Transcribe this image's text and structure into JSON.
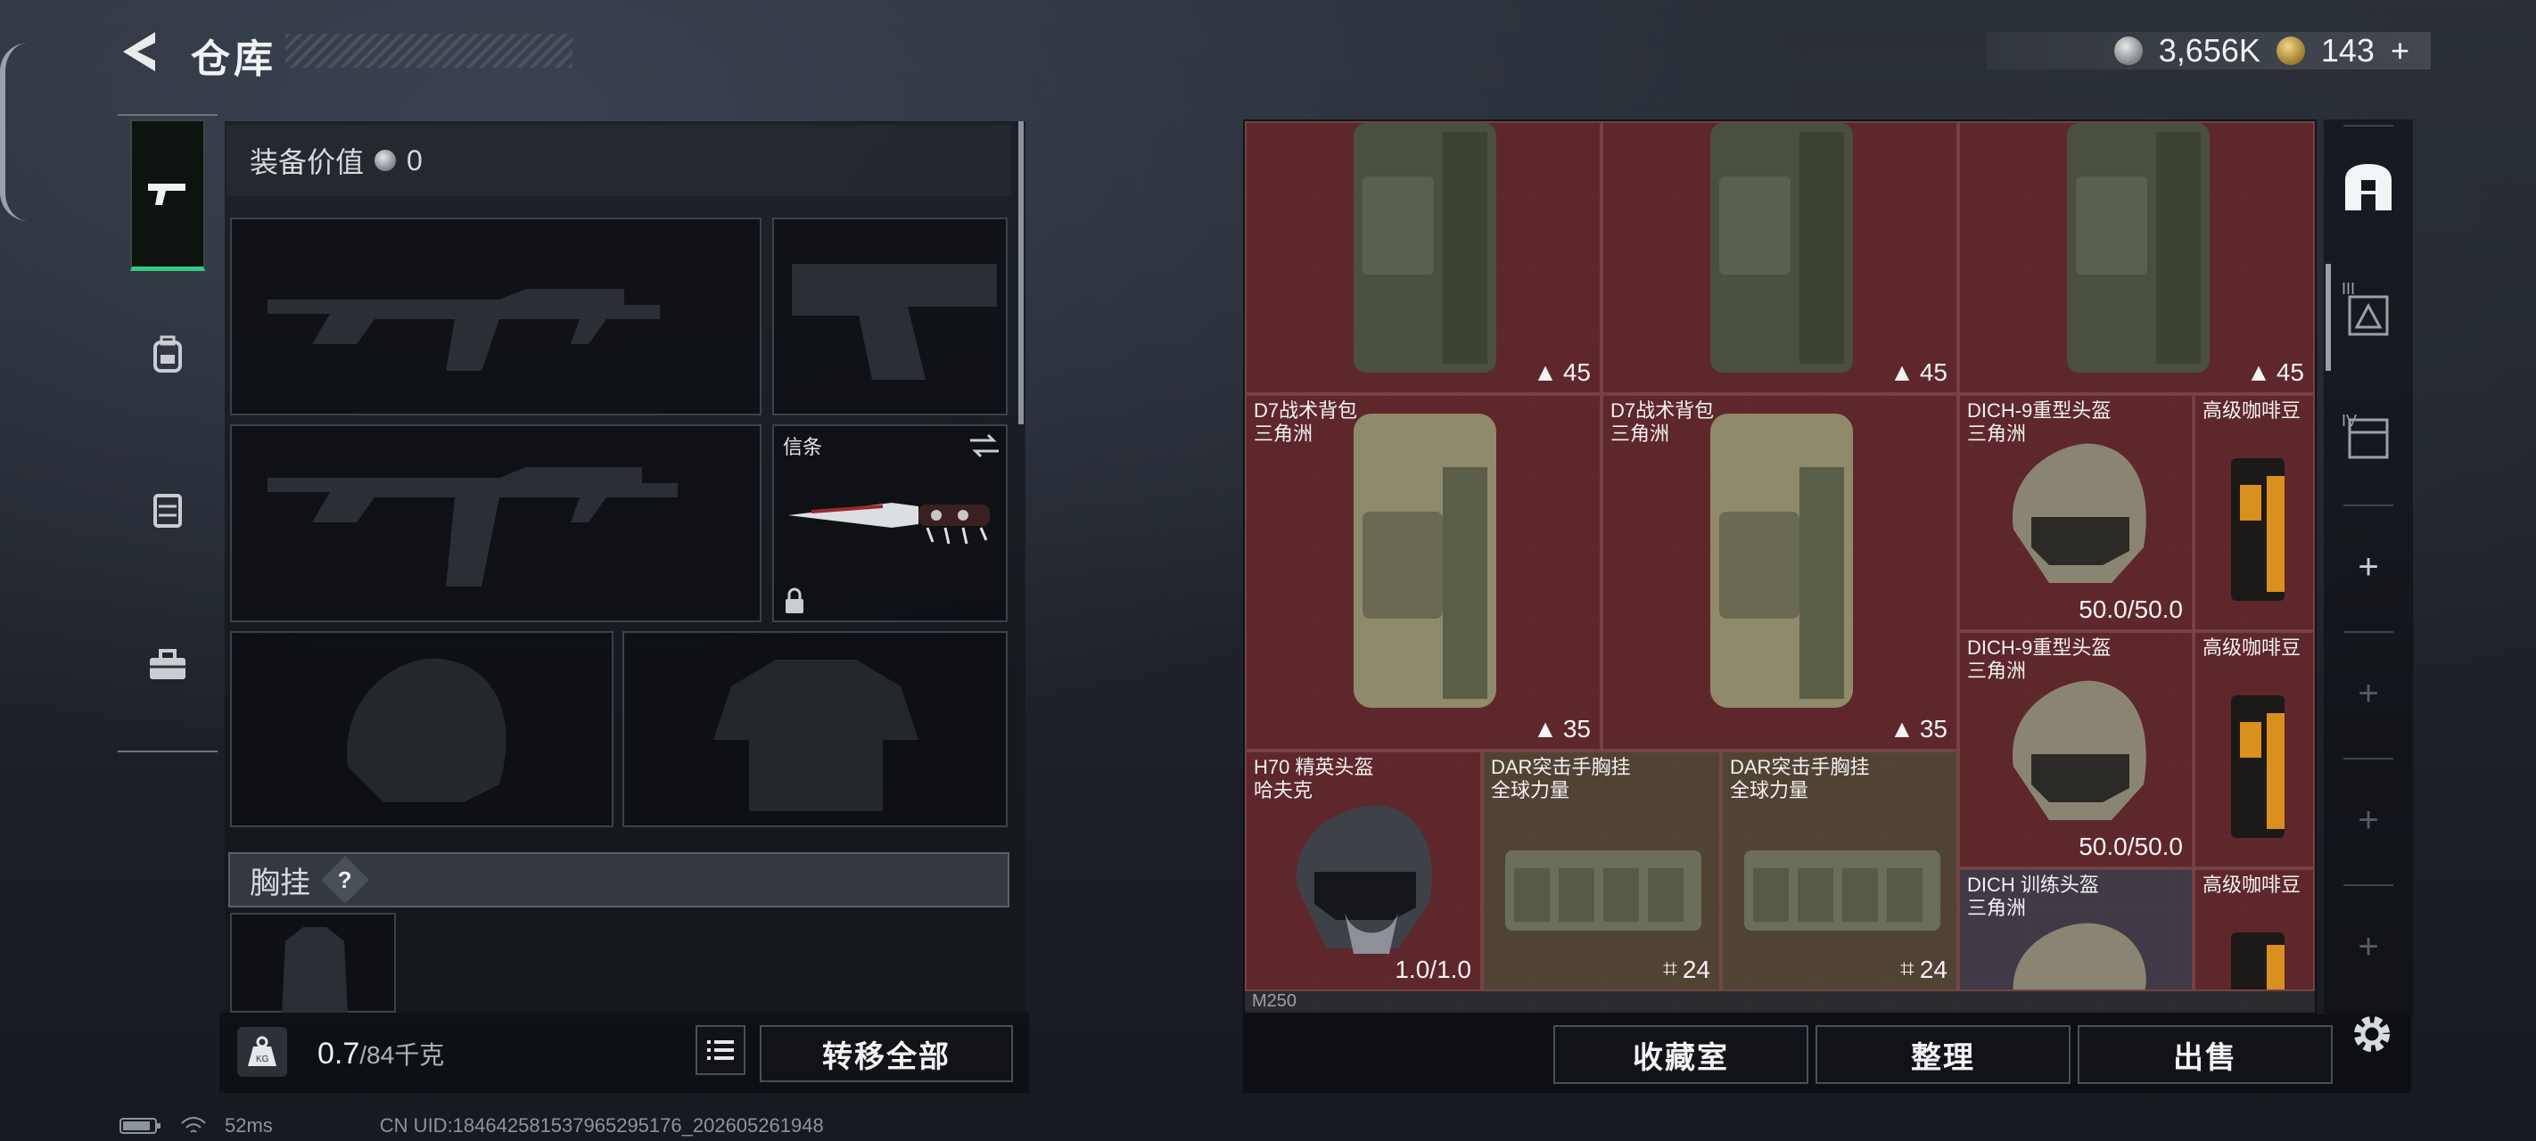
{
  "header": {
    "title": "仓库",
    "silver": "3,656K",
    "gold": "143",
    "gold_plus": "+"
  },
  "sidebar": {
    "tabs": [
      "gun-icon",
      "backpack-icon",
      "vest-icon",
      "toolbox-icon"
    ]
  },
  "equipment": {
    "value_label": "装备价值",
    "value_amount": "0",
    "melee_label": "信条",
    "chest_label": "胸挂",
    "chest_help": "?",
    "weight_current": "0.7",
    "weight_total": "/84千克",
    "transfer_all": "转移全部"
  },
  "stash": {
    "items": [
      {
        "name1": "",
        "name2": "",
        "stat": "45",
        "type": "backpack"
      },
      {
        "name1": "",
        "name2": "",
        "stat": "45",
        "type": "backpack"
      },
      {
        "name1": "",
        "name2": "",
        "stat": "45",
        "type": "backpack"
      },
      {
        "name1": "D7战术背包",
        "name2": "三角洲",
        "stat": "35",
        "type": "backpack"
      },
      {
        "name1": "D7战术背包",
        "name2": "三角洲",
        "stat": "35",
        "type": "backpack"
      },
      {
        "name1": "DICH-9重型头盔",
        "name2": "三角洲",
        "stat": "50.0/50.0",
        "type": "helmet"
      },
      {
        "name1": "高级咖啡豆",
        "name2": "",
        "stat": "",
        "type": "coffee"
      },
      {
        "name1": "DICH-9重型头盔",
        "name2": "三角洲",
        "stat": "50.0/50.0",
        "type": "helmet"
      },
      {
        "name1": "高级咖啡豆",
        "name2": "",
        "stat": "",
        "type": "coffee"
      },
      {
        "name1": "H70 精英头盔",
        "name2": "哈夫克",
        "stat": "1.0/1.0",
        "type": "helmet"
      },
      {
        "name1": "DAR突击手胸挂",
        "name2": "全球力量",
        "stat": "24",
        "type": "vest"
      },
      {
        "name1": "DAR突击手胸挂",
        "name2": "全球力量",
        "stat": "24",
        "type": "vest"
      },
      {
        "name1": "DICH 训练头盔",
        "name2": "三角洲",
        "stat": "",
        "type": "helmet"
      },
      {
        "name1": "高级咖啡豆",
        "name2": "",
        "stat": "",
        "type": "coffee"
      }
    ],
    "footer_label": "M250",
    "buttons": {
      "collection": "收藏室",
      "sort": "整理",
      "sell": "出售"
    }
  },
  "right_rail": {
    "roman_3": "III",
    "roman_4": "IV",
    "plus": "+"
  },
  "status": {
    "ping": "52ms",
    "uid": "CN UID:18464258153796529517​6_202605261948"
  }
}
